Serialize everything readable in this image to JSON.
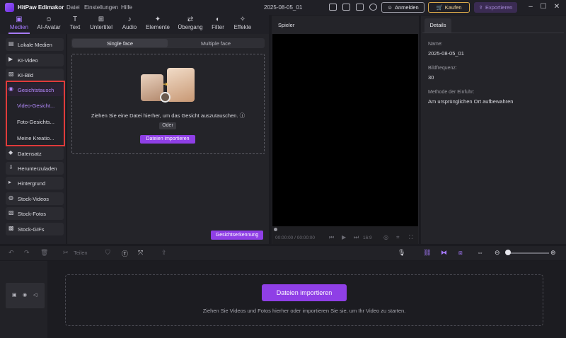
{
  "app": {
    "name": "HitPaw Edimakor",
    "menus": [
      "Datei",
      "Einstellungen",
      "Hilfe"
    ],
    "project_title": "2025-08-05_01",
    "login_label": "Anmelden",
    "buy_label": "Kaufen",
    "export_label": "Exportieren",
    "accent": "#8f3fe6"
  },
  "tools": [
    {
      "label": "Medien",
      "icon": "media-icon"
    },
    {
      "label": "AI-Avatar",
      "icon": "avatar-icon"
    },
    {
      "label": "Text",
      "icon": "text-icon"
    },
    {
      "label": "Untertitel",
      "icon": "subtitle-icon"
    },
    {
      "label": "Audio",
      "icon": "audio-icon"
    },
    {
      "label": "Elemente",
      "icon": "elements-icon"
    },
    {
      "label": "Übergang",
      "icon": "transition-icon"
    },
    {
      "label": "Filter",
      "icon": "filter-icon"
    },
    {
      "label": "Effekte",
      "icon": "effects-icon"
    }
  ],
  "sidebar": {
    "items": [
      {
        "label": "Lokale Medien"
      },
      {
        "label": "KI-Video"
      },
      {
        "label": "KI-Bild"
      },
      {
        "label": "Gesichtstausch"
      },
      {
        "label": "Datensatz"
      },
      {
        "label": "Herunterzuladen"
      },
      {
        "label": "Hintergrund"
      },
      {
        "label": "Stock-Videos"
      },
      {
        "label": "Stock-Fotos"
      },
      {
        "label": "Stock-GIFs"
      }
    ],
    "subitems": [
      "Video-Gesicht...",
      "Foto-Gesichts...",
      "Meine Kreatio..."
    ]
  },
  "faceswap": {
    "segments": [
      "Single face",
      "Multiple face"
    ],
    "drop_text": "Ziehen Sie eine Datei hierher, um das Gesicht auszutauschen.",
    "or_label": "Oder",
    "import_label": "Dateien importieren",
    "detect_label": "Gesichtserkennung"
  },
  "player": {
    "title": "Spieler",
    "timecode": "00:00:00 / 00:00:00",
    "ratio": "16:9"
  },
  "details": {
    "tab": "Details",
    "name_label": "Name:",
    "name_value": "2025-08-05_01",
    "fps_label": "Bildfrequenz:",
    "fps_value": "30",
    "insert_label": "Methode der Einfuhr:",
    "insert_value": "Am ursprünglichen Ort aufbewahren"
  },
  "timeline": {
    "split_label": "Teilen",
    "import_label": "Dateien importieren",
    "hint": "Ziehen Sie Videos und Fotos hierher oder importieren Sie sie, um Ihr Video zu starten."
  }
}
